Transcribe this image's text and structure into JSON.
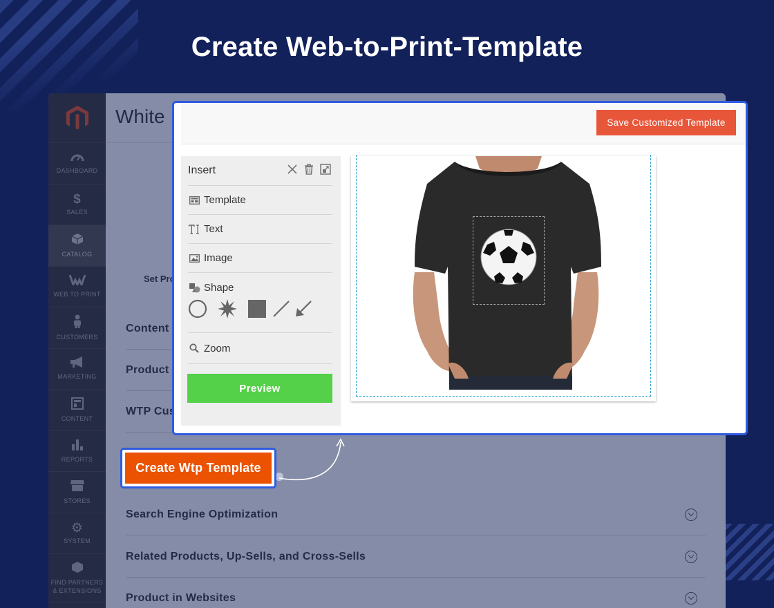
{
  "headline": "Create Web-to-Print-Template",
  "colors": {
    "background": "#13215a",
    "highlight_border": "#2f5be0",
    "admin_sidebar": "#373330",
    "save_button": "#e8563a",
    "create_button": "#eb5202",
    "preview_button": "#54d049",
    "canvas_dash": "#2aa2cf"
  },
  "admin": {
    "page_title": "White",
    "set_product_label": "Set Pro",
    "sidebar": [
      {
        "label": "DASHBOARD",
        "icon": "dashboard-icon"
      },
      {
        "label": "SALES",
        "icon": "dollar-icon"
      },
      {
        "label": "CATALOG",
        "icon": "catalog-box-icon",
        "active": true
      },
      {
        "label": "WEB TO PRINT",
        "icon": "web-to-print-icon"
      },
      {
        "label": "CUSTOMERS",
        "icon": "customers-icon"
      },
      {
        "label": "MARKETING",
        "icon": "megaphone-icon"
      },
      {
        "label": "CONTENT",
        "icon": "content-icon"
      },
      {
        "label": "REPORTS",
        "icon": "reports-icon"
      },
      {
        "label": "STORES",
        "icon": "stores-icon"
      },
      {
        "label": "SYSTEM",
        "icon": "gear-icon"
      },
      {
        "label": "FIND PARTNERS & EXTENSIONS",
        "icon": "extensions-icon"
      }
    ],
    "sections": [
      "Content",
      "Product",
      "WTP Cus",
      "Search Engine Optimization",
      "Related Products, Up-Sells, and Cross-Sells",
      "Product in Websites"
    ],
    "create_button": "Create Wtp Template"
  },
  "editor": {
    "save_button": "Save Customized Template",
    "panel_title": "Insert",
    "tools": [
      {
        "label": "Template",
        "icon": "template-icon"
      },
      {
        "label": "Text",
        "icon": "text-icon"
      },
      {
        "label": "Image",
        "icon": "image-icon"
      },
      {
        "label": "Shape",
        "icon": "shape-icon"
      },
      {
        "label": "Zoom",
        "icon": "zoom-icon"
      }
    ],
    "shapes": [
      "circle-shape-icon",
      "star-burst-shape-icon",
      "square-shape-icon",
      "line-shape-icon",
      "arrow-shape-icon"
    ],
    "preview_button": "Preview"
  }
}
